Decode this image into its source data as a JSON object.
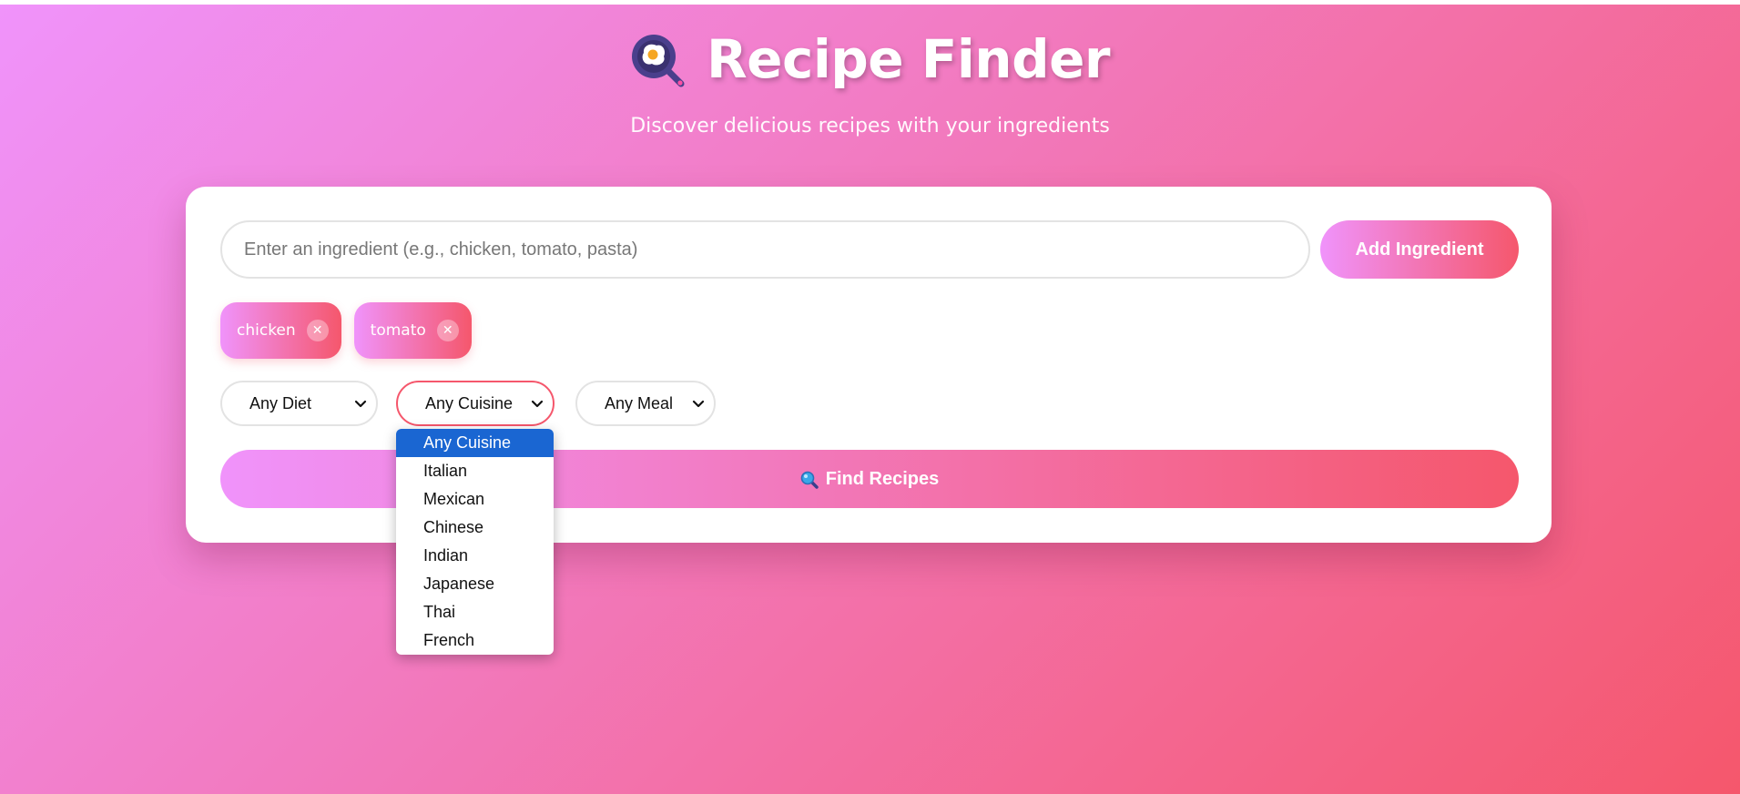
{
  "header": {
    "title": "Recipe Finder",
    "subtitle": "Discover delicious recipes with your ingredients",
    "logo_icon": "frying-pan-egg-icon"
  },
  "search": {
    "placeholder": "Enter an ingredient (e.g., chicken, tomato, pasta)",
    "value": "",
    "add_label": "Add Ingredient"
  },
  "ingredients": [
    {
      "label": "chicken",
      "remove_icon": "close-icon"
    },
    {
      "label": "tomato",
      "remove_icon": "close-icon"
    }
  ],
  "filters": {
    "diet": {
      "selected": "Any Diet"
    },
    "cuisine": {
      "selected": "Any Cuisine",
      "open": true,
      "options": [
        "Any Cuisine",
        "Italian",
        "Mexican",
        "Chinese",
        "Indian",
        "Japanese",
        "Thai",
        "French"
      ]
    },
    "meal": {
      "selected": "Any Meal"
    }
  },
  "find": {
    "label": "Find Recipes",
    "icon": "search-icon"
  },
  "colors": {
    "gradient_start": "#f093fb",
    "gradient_end": "#f5576c",
    "selected_option": "#1a66d2",
    "active_border": "#f5576c"
  }
}
